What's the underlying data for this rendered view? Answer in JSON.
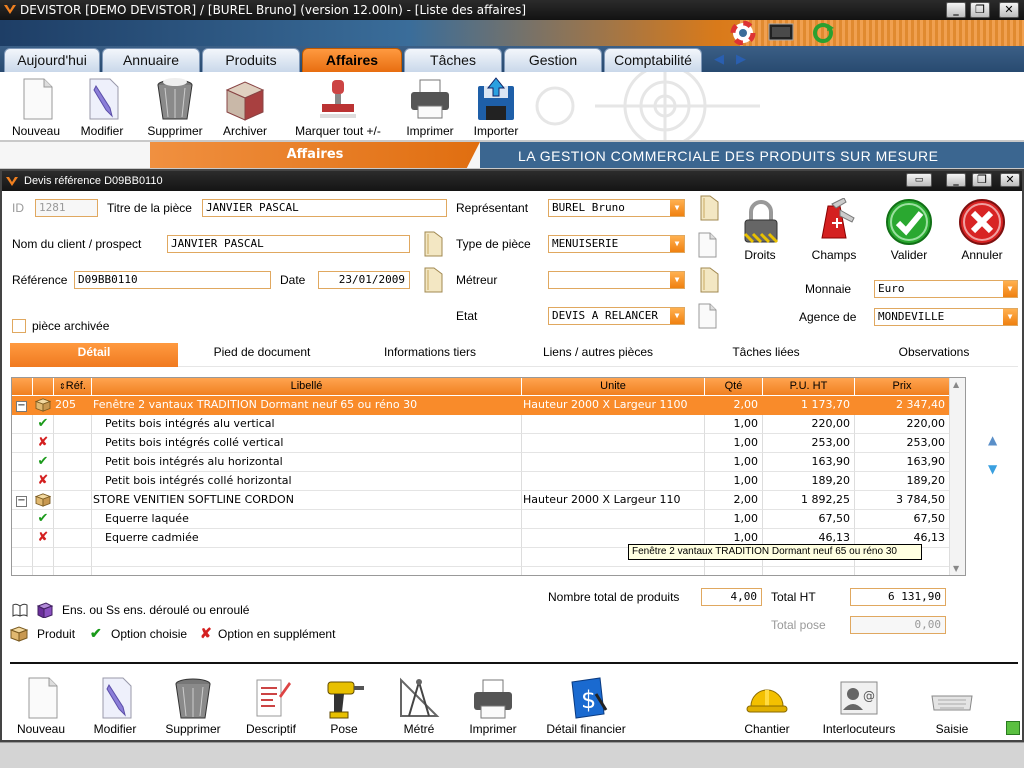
{
  "window": {
    "title": "DEVISTOR [DEMO DEVISTOR] / [BUREL Bruno] (version 12.00In) - [Liste des affaires]"
  },
  "main_tabs": [
    {
      "label": "Aujourd'hui"
    },
    {
      "label": "Annuaire"
    },
    {
      "label": "Produits"
    },
    {
      "label": "Affaires",
      "active": true
    },
    {
      "label": "Tâches"
    },
    {
      "label": "Gestion"
    },
    {
      "label": "Comptabilité"
    }
  ],
  "toolbar": [
    {
      "label": "Nouveau",
      "icon": "document-icon"
    },
    {
      "label": "Modifier",
      "icon": "edit-document-icon"
    },
    {
      "label": "Supprimer",
      "icon": "trash-bin-icon"
    },
    {
      "label": "Archiver",
      "icon": "archive-box-icon"
    },
    {
      "label": "Marquer tout +/-",
      "icon": "stamp-icon"
    },
    {
      "label": "Imprimer",
      "icon": "printer-icon"
    },
    {
      "label": "Importer",
      "icon": "import-disk-icon"
    }
  ],
  "banner": {
    "title": "Affaires",
    "slogan": "LA GESTION COMMERCIALE DES PRODUITS SUR MESURE"
  },
  "dialog": {
    "title": "Devis référence D09BB0110",
    "labels": {
      "id": "ID",
      "titre": "Titre de la pièce",
      "client": "Nom du client / prospect",
      "reference": "Référence",
      "date": "Date",
      "archived": "pièce archivée",
      "representant": "Représentant",
      "type": "Type de pièce",
      "metreur": "Métreur",
      "etat": "Etat",
      "monnaie": "Monnaie",
      "agence": "Agence de"
    },
    "values": {
      "id": "1281",
      "titre": "JANVIER PASCAL",
      "client": "JANVIER PASCAL",
      "reference": "D09BB0110",
      "date": "23/01/2009",
      "representant": "BUREL Bruno",
      "type": "MENUISERIE",
      "metreur": "",
      "etat": "DEVIS A RELANCER",
      "monnaie": "Euro",
      "agence": "MONDEVILLE"
    },
    "actions": [
      {
        "label": "Droits",
        "icon": "padlock-icon"
      },
      {
        "label": "Champs",
        "icon": "swiss-knife-icon"
      },
      {
        "label": "Valider",
        "icon": "check-circle-icon"
      },
      {
        "label": "Annuler",
        "icon": "cancel-circle-icon"
      }
    ],
    "sub_tabs": [
      {
        "label": "Détail",
        "active": true
      },
      {
        "label": "Pied de document"
      },
      {
        "label": "Informations tiers"
      },
      {
        "label": "Liens / autres pièces"
      },
      {
        "label": "Tâches liées"
      },
      {
        "label": "Observations"
      }
    ],
    "grid": {
      "columns": [
        "Réf.",
        "Libellé",
        "Unite",
        "Qté",
        "P.U. HT",
        "Prix"
      ],
      "rows": [
        {
          "kind": "product",
          "expand": "−",
          "ref": "205",
          "label": "Fenêtre 2 vantaux TRADITION Dormant neuf 65 ou réno 30",
          "unit": "Hauteur 2000 X Largeur 1100",
          "qty": "2,00",
          "pu": "1 173,70",
          "price": "2 347,40",
          "selected": true
        },
        {
          "kind": "option",
          "ref": "",
          "label": "Petits bois intégrés alu vertical",
          "unit": "",
          "qty": "1,00",
          "pu": "220,00",
          "price": "220,00"
        },
        {
          "kind": "supplement",
          "ref": "",
          "label": "Petits bois intégrés collé vertical",
          "unit": "",
          "qty": "1,00",
          "pu": "253,00",
          "price": "253,00"
        },
        {
          "kind": "option",
          "ref": "",
          "label": "Petit bois intégrés alu horizontal",
          "unit": "",
          "qty": "1,00",
          "pu": "163,90",
          "price": "163,90"
        },
        {
          "kind": "supplement",
          "ref": "",
          "label": "Petit bois intégrés collé horizontal",
          "unit": "",
          "qty": "1,00",
          "pu": "189,20",
          "price": "189,20"
        },
        {
          "kind": "product",
          "expand": "−",
          "ref": "",
          "label": "STORE VENITIEN SOFTLINE CORDON",
          "unit": "Hauteur 2000 X Largeur 110",
          "qty": "2,00",
          "pu": "1 892,25",
          "price": "3 784,50"
        },
        {
          "kind": "option",
          "ref": "",
          "label": "Equerre laquée",
          "unit": "",
          "qty": "1,00",
          "pu": "67,50",
          "price": "67,50"
        },
        {
          "kind": "supplement",
          "ref": "",
          "label": "Equerre cadmiée",
          "unit": "",
          "qty": "1,00",
          "pu": "46,13",
          "price": "46,13"
        }
      ]
    },
    "tooltip": "Fenêtre 2 vantaux TRADITION Dormant neuf 65 ou réno 30",
    "totals": {
      "nb_label": "Nombre total de produits",
      "nb_value": "4,00",
      "ht_label": "Total HT",
      "ht_value": "6 131,90",
      "pose_label": "Total pose",
      "pose_value": "0,00"
    },
    "legend": {
      "ensemble": "Ens. ou Ss ens. déroulé ou enroulé",
      "produit": "Produit",
      "option": "Option choisie",
      "supplement": "Option en supplément"
    },
    "bottom_toolbar": [
      {
        "label": "Nouveau",
        "icon": "document-icon"
      },
      {
        "label": "Modifier",
        "icon": "edit-document-icon"
      },
      {
        "label": "Supprimer",
        "icon": "trash-bin-icon"
      },
      {
        "label": "Descriptif",
        "icon": "description-icon"
      },
      {
        "label": "Pose",
        "icon": "drill-icon"
      },
      {
        "label": "Métré",
        "icon": "compass-ruler-icon"
      },
      {
        "label": "Imprimer",
        "icon": "printer-icon"
      },
      {
        "label": "Détail financier",
        "icon": "dollar-document-icon"
      },
      {
        "label": "Chantier",
        "icon": "hard-hat-icon"
      },
      {
        "label": "Interlocuteurs",
        "icon": "contact-card-icon"
      },
      {
        "label": "Saisie",
        "icon": "keyboard-icon"
      }
    ]
  },
  "colors": {
    "accent": "#f08020",
    "header_blue": "#2c5a86",
    "ok_green": "#1a9a1a",
    "cancel_red": "#d42020"
  }
}
